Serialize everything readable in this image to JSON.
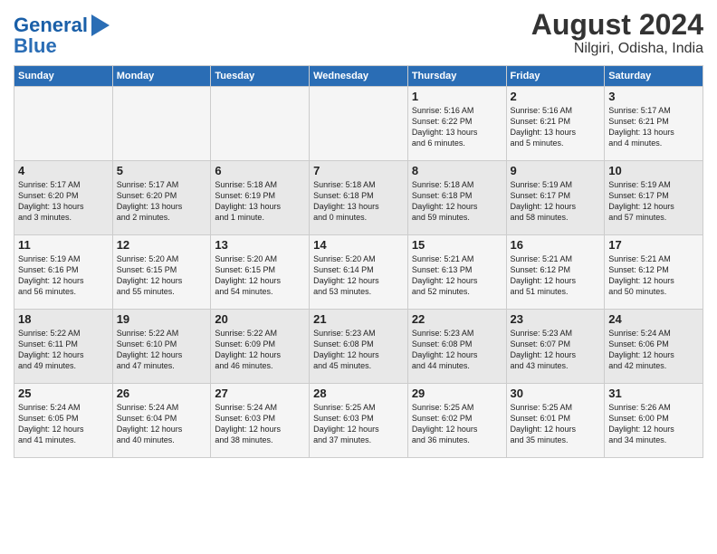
{
  "header": {
    "logo_line1": "General",
    "logo_line2": "Blue",
    "title": "August 2024",
    "subtitle": "Nilgiri, Odisha, India"
  },
  "weekdays": [
    "Sunday",
    "Monday",
    "Tuesday",
    "Wednesday",
    "Thursday",
    "Friday",
    "Saturday"
  ],
  "weeks": [
    [
      {
        "day": "",
        "info": ""
      },
      {
        "day": "",
        "info": ""
      },
      {
        "day": "",
        "info": ""
      },
      {
        "day": "",
        "info": ""
      },
      {
        "day": "1",
        "info": "Sunrise: 5:16 AM\nSunset: 6:22 PM\nDaylight: 13 hours\nand 6 minutes."
      },
      {
        "day": "2",
        "info": "Sunrise: 5:16 AM\nSunset: 6:21 PM\nDaylight: 13 hours\nand 5 minutes."
      },
      {
        "day": "3",
        "info": "Sunrise: 5:17 AM\nSunset: 6:21 PM\nDaylight: 13 hours\nand 4 minutes."
      }
    ],
    [
      {
        "day": "4",
        "info": "Sunrise: 5:17 AM\nSunset: 6:20 PM\nDaylight: 13 hours\nand 3 minutes."
      },
      {
        "day": "5",
        "info": "Sunrise: 5:17 AM\nSunset: 6:20 PM\nDaylight: 13 hours\nand 2 minutes."
      },
      {
        "day": "6",
        "info": "Sunrise: 5:18 AM\nSunset: 6:19 PM\nDaylight: 13 hours\nand 1 minute."
      },
      {
        "day": "7",
        "info": "Sunrise: 5:18 AM\nSunset: 6:18 PM\nDaylight: 13 hours\nand 0 minutes."
      },
      {
        "day": "8",
        "info": "Sunrise: 5:18 AM\nSunset: 6:18 PM\nDaylight: 12 hours\nand 59 minutes."
      },
      {
        "day": "9",
        "info": "Sunrise: 5:19 AM\nSunset: 6:17 PM\nDaylight: 12 hours\nand 58 minutes."
      },
      {
        "day": "10",
        "info": "Sunrise: 5:19 AM\nSunset: 6:17 PM\nDaylight: 12 hours\nand 57 minutes."
      }
    ],
    [
      {
        "day": "11",
        "info": "Sunrise: 5:19 AM\nSunset: 6:16 PM\nDaylight: 12 hours\nand 56 minutes."
      },
      {
        "day": "12",
        "info": "Sunrise: 5:20 AM\nSunset: 6:15 PM\nDaylight: 12 hours\nand 55 minutes."
      },
      {
        "day": "13",
        "info": "Sunrise: 5:20 AM\nSunset: 6:15 PM\nDaylight: 12 hours\nand 54 minutes."
      },
      {
        "day": "14",
        "info": "Sunrise: 5:20 AM\nSunset: 6:14 PM\nDaylight: 12 hours\nand 53 minutes."
      },
      {
        "day": "15",
        "info": "Sunrise: 5:21 AM\nSunset: 6:13 PM\nDaylight: 12 hours\nand 52 minutes."
      },
      {
        "day": "16",
        "info": "Sunrise: 5:21 AM\nSunset: 6:12 PM\nDaylight: 12 hours\nand 51 minutes."
      },
      {
        "day": "17",
        "info": "Sunrise: 5:21 AM\nSunset: 6:12 PM\nDaylight: 12 hours\nand 50 minutes."
      }
    ],
    [
      {
        "day": "18",
        "info": "Sunrise: 5:22 AM\nSunset: 6:11 PM\nDaylight: 12 hours\nand 49 minutes."
      },
      {
        "day": "19",
        "info": "Sunrise: 5:22 AM\nSunset: 6:10 PM\nDaylight: 12 hours\nand 47 minutes."
      },
      {
        "day": "20",
        "info": "Sunrise: 5:22 AM\nSunset: 6:09 PM\nDaylight: 12 hours\nand 46 minutes."
      },
      {
        "day": "21",
        "info": "Sunrise: 5:23 AM\nSunset: 6:08 PM\nDaylight: 12 hours\nand 45 minutes."
      },
      {
        "day": "22",
        "info": "Sunrise: 5:23 AM\nSunset: 6:08 PM\nDaylight: 12 hours\nand 44 minutes."
      },
      {
        "day": "23",
        "info": "Sunrise: 5:23 AM\nSunset: 6:07 PM\nDaylight: 12 hours\nand 43 minutes."
      },
      {
        "day": "24",
        "info": "Sunrise: 5:24 AM\nSunset: 6:06 PM\nDaylight: 12 hours\nand 42 minutes."
      }
    ],
    [
      {
        "day": "25",
        "info": "Sunrise: 5:24 AM\nSunset: 6:05 PM\nDaylight: 12 hours\nand 41 minutes."
      },
      {
        "day": "26",
        "info": "Sunrise: 5:24 AM\nSunset: 6:04 PM\nDaylight: 12 hours\nand 40 minutes."
      },
      {
        "day": "27",
        "info": "Sunrise: 5:24 AM\nSunset: 6:03 PM\nDaylight: 12 hours\nand 38 minutes."
      },
      {
        "day": "28",
        "info": "Sunrise: 5:25 AM\nSunset: 6:03 PM\nDaylight: 12 hours\nand 37 minutes."
      },
      {
        "day": "29",
        "info": "Sunrise: 5:25 AM\nSunset: 6:02 PM\nDaylight: 12 hours\nand 36 minutes."
      },
      {
        "day": "30",
        "info": "Sunrise: 5:25 AM\nSunset: 6:01 PM\nDaylight: 12 hours\nand 35 minutes."
      },
      {
        "day": "31",
        "info": "Sunrise: 5:26 AM\nSunset: 6:00 PM\nDaylight: 12 hours\nand 34 minutes."
      }
    ]
  ]
}
